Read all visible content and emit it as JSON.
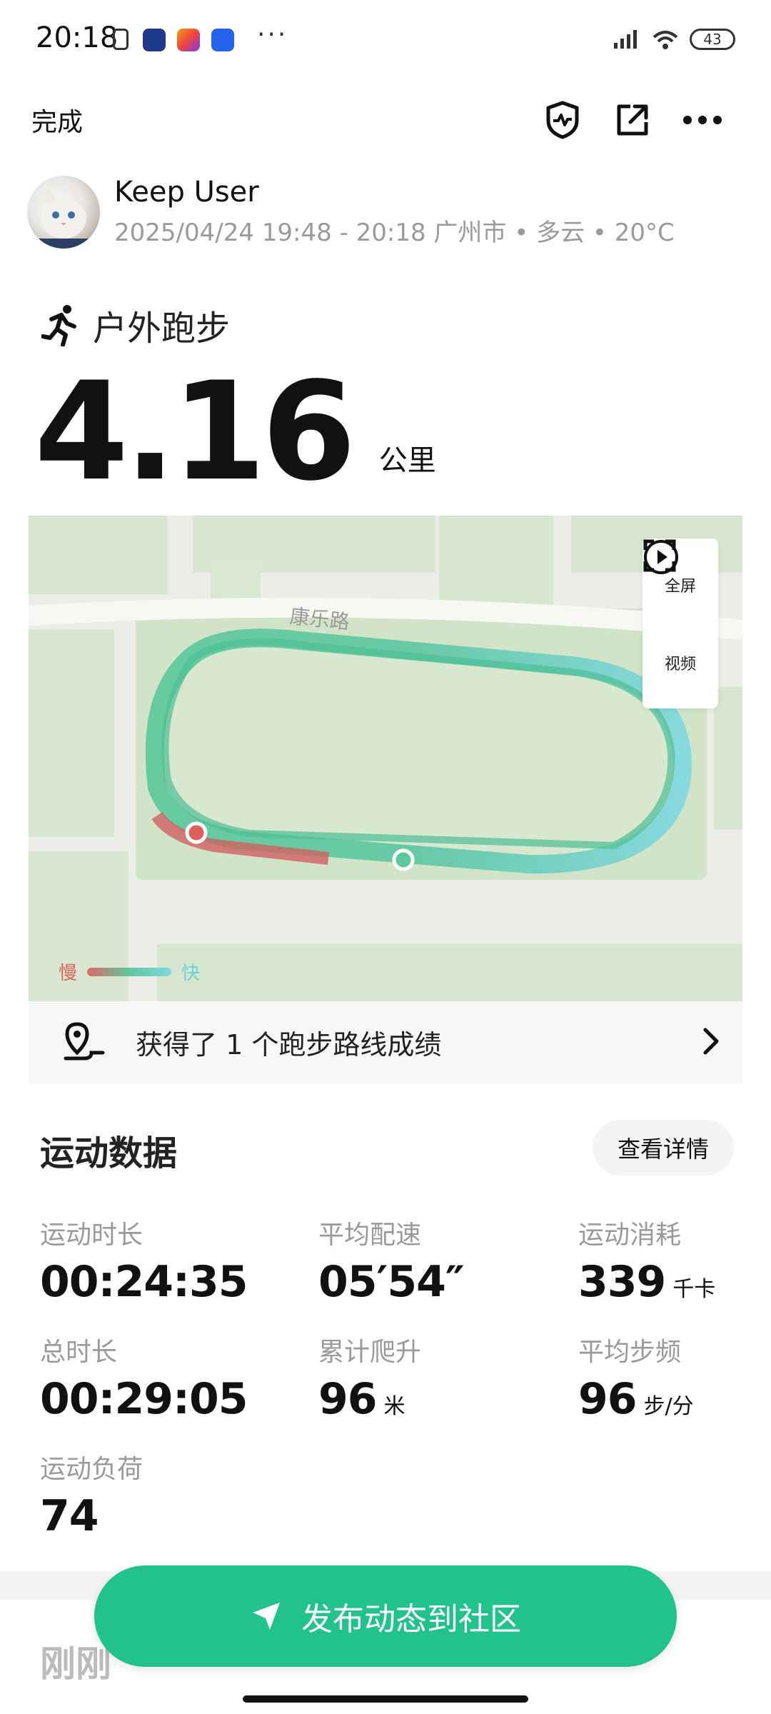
{
  "status_bar": {
    "time": "20:18",
    "dots": "···",
    "battery": "43"
  },
  "topbar": {
    "done_label": "完成"
  },
  "user": {
    "name": "Keep User",
    "meta": "2025/04/24 19:48 - 20:18 广州市 • 多云 • 20°C"
  },
  "activity": {
    "type_label": "户外跑步",
    "distance": "4.16",
    "distance_unit": "公里"
  },
  "map": {
    "street_label": "康乐路",
    "fullscreen_label": "全屏",
    "video_label": "视频",
    "legend_slow": "慢",
    "legend_fast": "快",
    "route_colors": {
      "slow": "#e06868",
      "mid": "#5cc99b",
      "fast": "#7fd8e0"
    }
  },
  "route_banner": {
    "text": "获得了 1 个跑步路线成绩"
  },
  "stats_section": {
    "title": "运动数据",
    "detail_button": "查看详情",
    "items": [
      {
        "label": "运动时长",
        "value": "00:24:35",
        "unit": ""
      },
      {
        "label": "平均配速",
        "value": "05′54″",
        "unit": ""
      },
      {
        "label": "运动消耗",
        "value": "339",
        "unit": "千卡"
      },
      {
        "label": "总时长",
        "value": "00:29:05",
        "unit": ""
      },
      {
        "label": "累计爬升",
        "value": "96",
        "unit": "米"
      },
      {
        "label": "平均步频",
        "value": "96",
        "unit": "步/分"
      },
      {
        "label": "运动负荷",
        "value": "74",
        "unit": ""
      }
    ]
  },
  "publish_button": {
    "label": "发布动态到社区"
  },
  "below_text": "刚刚"
}
